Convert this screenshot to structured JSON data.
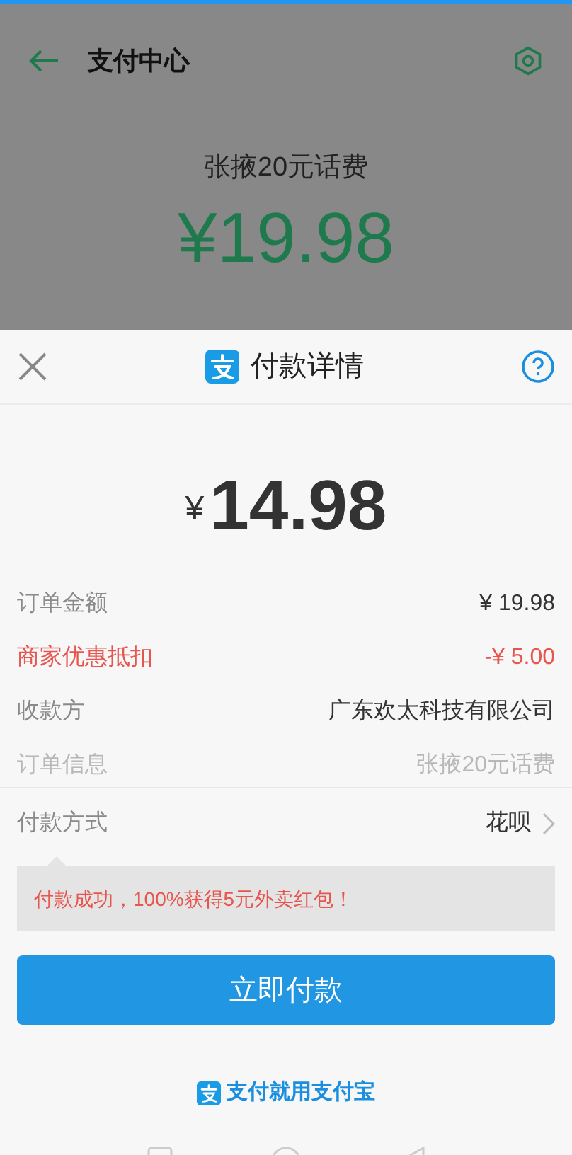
{
  "background_page": {
    "title": "支付中心",
    "product": "张掖20元话费",
    "amount": "¥19.98"
  },
  "sheet": {
    "title": "付款详情",
    "amount_symbol": "¥",
    "amount": "14.98",
    "rows": [
      {
        "label": "订单金额",
        "value": "¥ 19.98",
        "kind": "normal"
      },
      {
        "label": "商家优惠抵扣",
        "value": "-¥ 5.00",
        "kind": "discount"
      },
      {
        "label": "收款方",
        "value": "广东欢太科技有限公司",
        "kind": "normal"
      },
      {
        "label": "订单信息",
        "value": "张掖20元话费",
        "kind": "faded"
      }
    ],
    "payment_method": {
      "label": "付款方式",
      "value": "花呗"
    },
    "promo": "付款成功，100%获得5元外卖红包！",
    "pay_button": "立即付款",
    "footer": "支付就用支付宝"
  }
}
